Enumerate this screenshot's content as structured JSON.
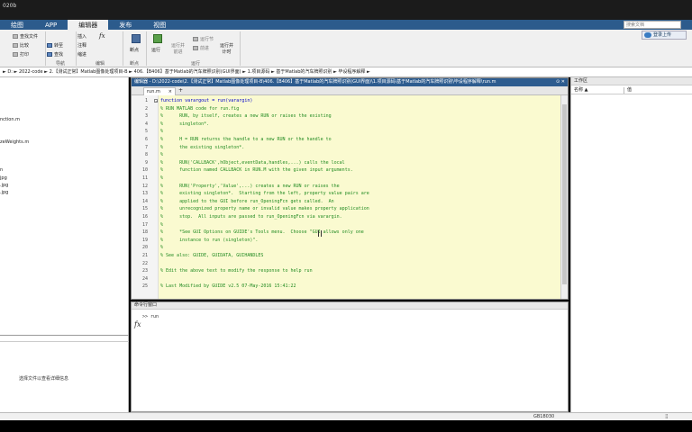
{
  "window": {
    "title": "020b"
  },
  "tabs": [
    {
      "label": "绘图",
      "active": false
    },
    {
      "label": "APP",
      "active": false
    },
    {
      "label": "编辑器",
      "active": true
    },
    {
      "label": "发布",
      "active": false
    },
    {
      "label": "视图",
      "active": false
    }
  ],
  "search": {
    "placeholder": "搜索文档"
  },
  "login": {
    "label": "登录上传"
  },
  "ribbon": {
    "file": {
      "find_files": "查找文件",
      "compare": "比较",
      "print": "打印"
    },
    "navigate": {
      "goto": "转至",
      "find": "查找"
    },
    "edit": {
      "insert": "插入",
      "comment": "注释",
      "indent": "缩进",
      "fx": "fx",
      "group_label": "编辑"
    },
    "breakpoints": {
      "label": "断点",
      "group_label": "断点"
    },
    "run": {
      "run": "运行",
      "run_advance": "运行并\n前进",
      "run_section": "运行节",
      "advance": "前进",
      "run_time": "运行并\n计时",
      "group_label": "运行"
    },
    "navigate_group_label": "导航"
  },
  "address": {
    "path": "► D: ► 2022-code ► 2.【测试正常】Matlab图像处理项目-B ► 406.【B406】基于Matlab的汽车牌照识别(GUI界面) ► 1.项目源码 ► 基于Matlab的汽车牌照识别 ► 毕设程序解释 ►"
  },
  "left_panel": {
    "files": [
      "nction.m",
      "zeWeights.m",
      "n",
      "jpg",
      ".jpg",
      ".jpg"
    ],
    "detail_text": "选择文件以查看详细信息"
  },
  "editor": {
    "title": "编辑器 - D:\\2022-code\\2.【测试正常】Matlab图像处理项目-B\\406.【B406】基于Matlab的汽车牌照识别(GUI界面)\\1.项目源码\\基于Matlab的汽车牌照识别\\毕设程序解释\\run.m",
    "tab_label": "run.m",
    "lines": [
      {
        "n": "1",
        "text": "function varargout = run(varargin)",
        "kind": "kw"
      },
      {
        "n": "2",
        "text": "% RUN MATLAB code for run.fig",
        "kind": "comment"
      },
      {
        "n": "3",
        "text": "%      RUN, by itself, creates a new RUN or raises the existing",
        "kind": "comment"
      },
      {
        "n": "4",
        "text": "%      singleton*.",
        "kind": "comment"
      },
      {
        "n": "5",
        "text": "%",
        "kind": "comment"
      },
      {
        "n": "6",
        "text": "%      H = RUN returns the handle to a new RUN or the handle to",
        "kind": "comment"
      },
      {
        "n": "7",
        "text": "%      the existing singleton*.",
        "kind": "comment"
      },
      {
        "n": "8",
        "text": "%",
        "kind": "comment"
      },
      {
        "n": "9",
        "text": "%      RUN('CALLBACK',hObject,eventData,handles,...) calls the local",
        "kind": "comment"
      },
      {
        "n": "10",
        "text": "%      function named CALLBACK in RUN.M with the given input arguments.",
        "kind": "comment"
      },
      {
        "n": "11",
        "text": "%",
        "kind": "comment"
      },
      {
        "n": "12",
        "text": "%      RUN('Property','Value',...) creates a new RUN or raises the",
        "kind": "comment"
      },
      {
        "n": "13",
        "text": "%      existing singleton*.  Starting from the left, property value pairs are",
        "kind": "comment"
      },
      {
        "n": "14",
        "text": "%      applied to the GUI before run_OpeningFcn gets called.  An",
        "kind": "comment"
      },
      {
        "n": "15",
        "text": "%      unrecognized property name or invalid value makes property application",
        "kind": "comment"
      },
      {
        "n": "16",
        "text": "%      stop.  All inputs are passed to run_OpeningFcn via varargin.",
        "kind": "comment"
      },
      {
        "n": "17",
        "text": "%",
        "kind": "comment"
      },
      {
        "n": "18",
        "text": "%      *See GUI Options on GUIDE's Tools menu.  Choose \"GUI allows only one",
        "kind": "comment"
      },
      {
        "n": "19",
        "text": "%      instance to run (singleton)\".",
        "kind": "comment"
      },
      {
        "n": "20",
        "text": "%",
        "kind": "comment"
      },
      {
        "n": "21",
        "text": "% See also: GUIDE, GUIDATA, GUIHANDLES",
        "kind": "comment"
      },
      {
        "n": "22",
        "text": "",
        "kind": "comment"
      },
      {
        "n": "23",
        "text": "% Edit the above text to modify the response to help run",
        "kind": "comment"
      },
      {
        "n": "24",
        "text": "",
        "kind": "comment"
      },
      {
        "n": "25",
        "text": "% Last Modified by GUIDE v2.5 07-May-2016 15:41:22",
        "kind": "comment"
      }
    ]
  },
  "command_window": {
    "title": "命令行窗口",
    "history": ">> run",
    "fx": "fx"
  },
  "workspace": {
    "title": "工作区",
    "col_name": "名称 ▲",
    "col_value": "值"
  },
  "status": {
    "text": "GB18030",
    "grip": "⣿"
  },
  "colors": {
    "tab_bar": "#2c5b8c",
    "editor_bg": "#fafad0",
    "comment": "#228b22",
    "keyword": "#0000cc"
  }
}
